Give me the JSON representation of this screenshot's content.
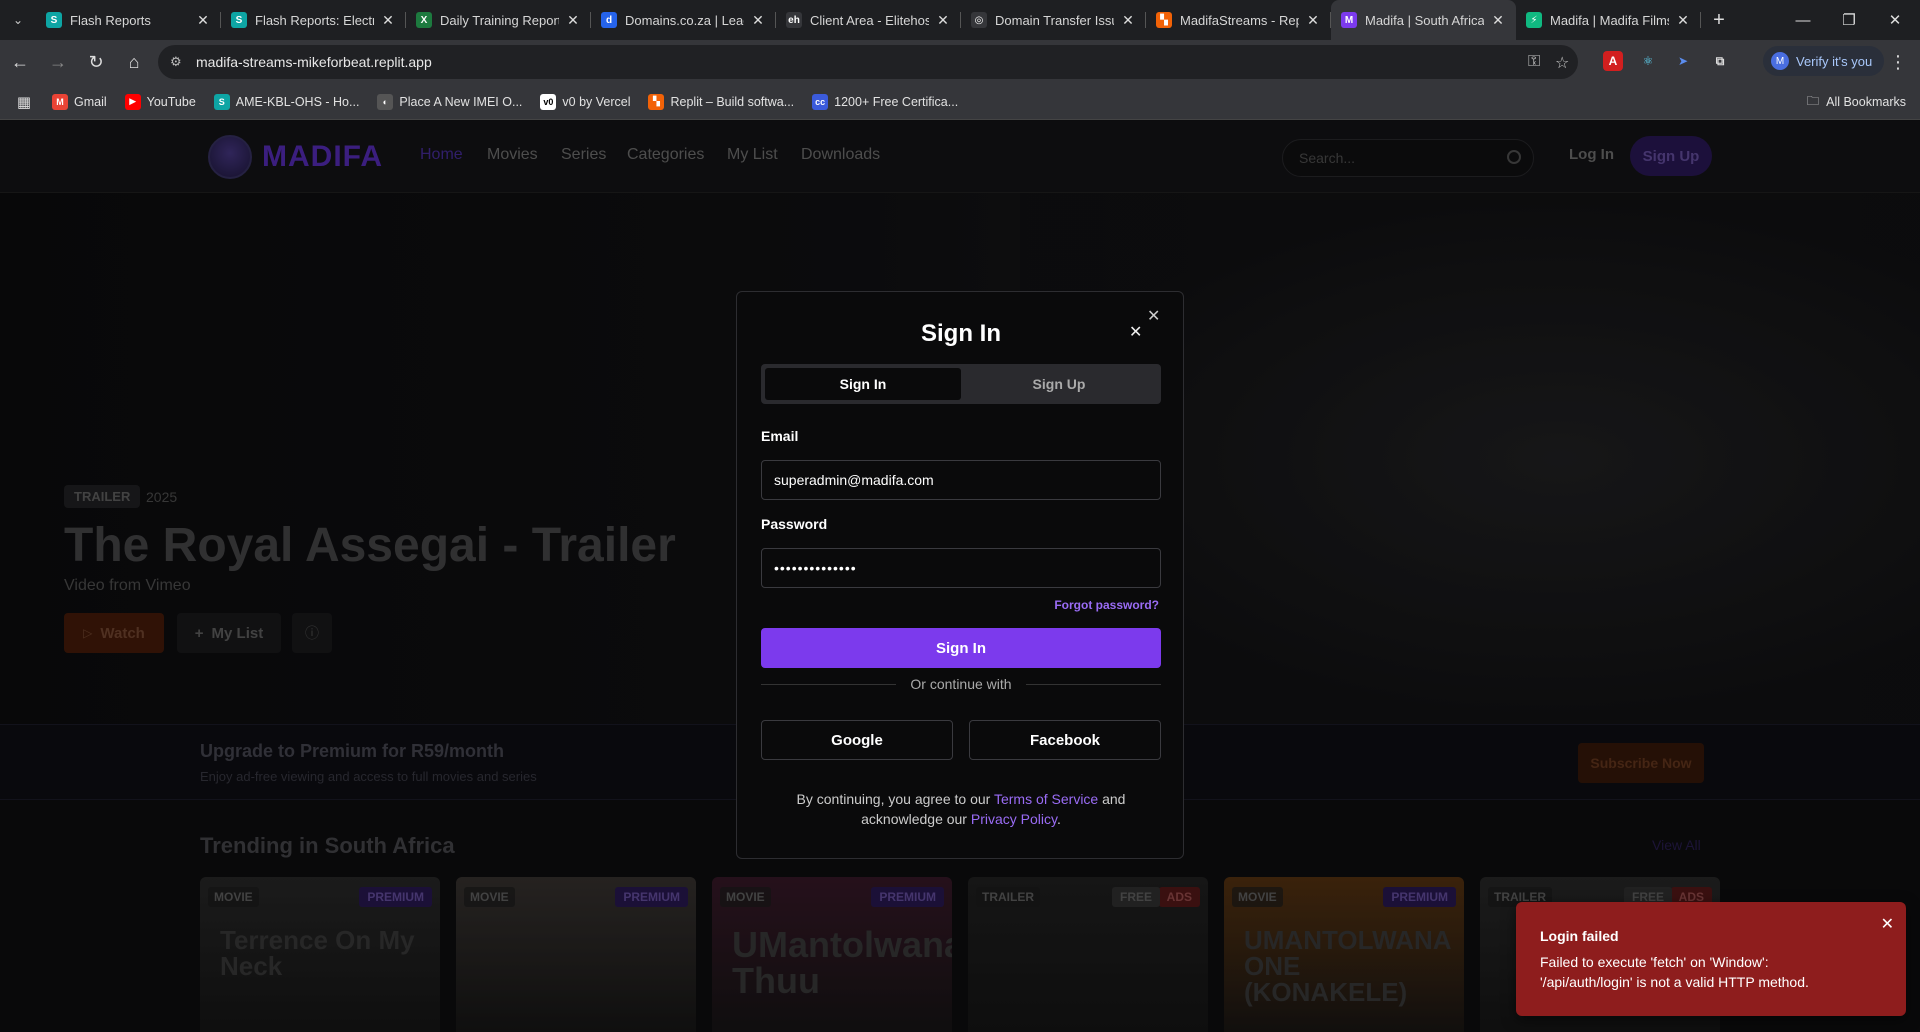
{
  "browser": {
    "tabs": [
      {
        "title": "Flash Reports",
        "favicon": "S",
        "color": "#0ea5a4"
      },
      {
        "title": "Flash Reports: Electric",
        "favicon": "S",
        "color": "#0ea5a4"
      },
      {
        "title": "Daily Training Report",
        "favicon": "X",
        "color": "#1d7a3f"
      },
      {
        "title": "Domains.co.za | Leadi",
        "favicon": "d",
        "color": "#2563eb"
      },
      {
        "title": "Client Area - Elitehost",
        "favicon": "eh",
        "color": "#35363a"
      },
      {
        "title": "Domain Transfer Issu",
        "favicon": "◎",
        "color": "#35363a"
      },
      {
        "title": "MadifaStreams - Repl",
        "favicon": "▚",
        "color": "#f26207"
      },
      {
        "title": "Madifa | South African",
        "favicon": "M",
        "color": "#7c3aed",
        "active": true
      },
      {
        "title": "Madifa | Madifa Films",
        "favicon": "⚡",
        "color": "#10b981"
      }
    ],
    "url": "madifa-streams-mikeforbeat.replit.app",
    "verify_label": "Verify it's you",
    "verify_avatar": "M",
    "bookmarks": [
      {
        "label": "Gmail",
        "favicon": "M",
        "color": "#ea4335"
      },
      {
        "label": "YouTube",
        "favicon": "▶",
        "color": "#ff0000"
      },
      {
        "label": "AME-KBL-OHS - Ho...",
        "favicon": "S",
        "color": "#0ea5a4"
      },
      {
        "label": "Place A New IMEI O...",
        "favicon": "◐",
        "color": "#555"
      },
      {
        "label": "v0 by Vercel",
        "favicon": "v0",
        "color": "#fff"
      },
      {
        "label": "Replit – Build softwa...",
        "favicon": "▚",
        "color": "#f26207"
      },
      {
        "label": "1200+ Free Certifica...",
        "favicon": "cc",
        "color": "#3b5bdb"
      }
    ],
    "all_bookmarks": "All Bookmarks"
  },
  "site": {
    "logo_text": "MADIFA",
    "nav": [
      "Home",
      "Movies",
      "Series",
      "Categories",
      "My List",
      "Downloads"
    ],
    "search_placeholder": "Search...",
    "login": "Log In",
    "signup": "Sign Up"
  },
  "hero": {
    "badge": "TRAILER",
    "year": "2025",
    "title": "The Royal Assegai - Trailer",
    "subtitle": "Video from Vimeo",
    "watch": "Watch",
    "mylist": "My List"
  },
  "promo": {
    "title": "Upgrade to Premium for R59/month",
    "subtitle": "Enjoy ad-free viewing and access to full movies and series",
    "button": "Subscribe Now"
  },
  "trending": {
    "title": "Trending in South Africa",
    "view_all": "View All",
    "cards": [
      {
        "type": "MOVIE",
        "tags": [
          "PREMIUM"
        ],
        "text": "Terrence On My Neck",
        "bg": "#2a2a2a"
      },
      {
        "type": "MOVIE",
        "tags": [
          "PREMIUM"
        ],
        "text": "",
        "bg": "#3a3532"
      },
      {
        "type": "MOVIE",
        "tags": [
          "PREMIUM"
        ],
        "text": "UMantolwana Thuu",
        "bg": "#3a1a2a"
      },
      {
        "type": "TRAILER",
        "tags": [
          "FREE",
          "ADS"
        ],
        "text": "",
        "bg": "#222"
      },
      {
        "type": "MOVIE",
        "tags": [
          "PREMIUM"
        ],
        "text": "UMANTOLWANA ONE (KONAKELE)",
        "bg": "#5a3512"
      },
      {
        "type": "TRAILER",
        "tags": [
          "FREE",
          "ADS"
        ],
        "text": "",
        "bg": "#2a2a2a"
      }
    ]
  },
  "modal": {
    "title": "Sign In",
    "tab_signin": "Sign In",
    "tab_signup": "Sign Up",
    "email_label": "Email",
    "email_value": "superadmin@madifa.com",
    "password_label": "Password",
    "password_value": "••••••••••••••",
    "forgot": "Forgot password?",
    "submit": "Sign In",
    "divider": "Or continue with",
    "google": "Google",
    "facebook": "Facebook",
    "legal_pre": "By continuing, you agree to our ",
    "terms": "Terms of Service",
    "legal_mid": " and acknowledge our ",
    "privacy": "Privacy Policy",
    "legal_end": "."
  },
  "toast": {
    "title": "Login failed",
    "message": "Failed to execute 'fetch' on 'Window': '/api/auth/login' is not a valid HTTP method."
  }
}
